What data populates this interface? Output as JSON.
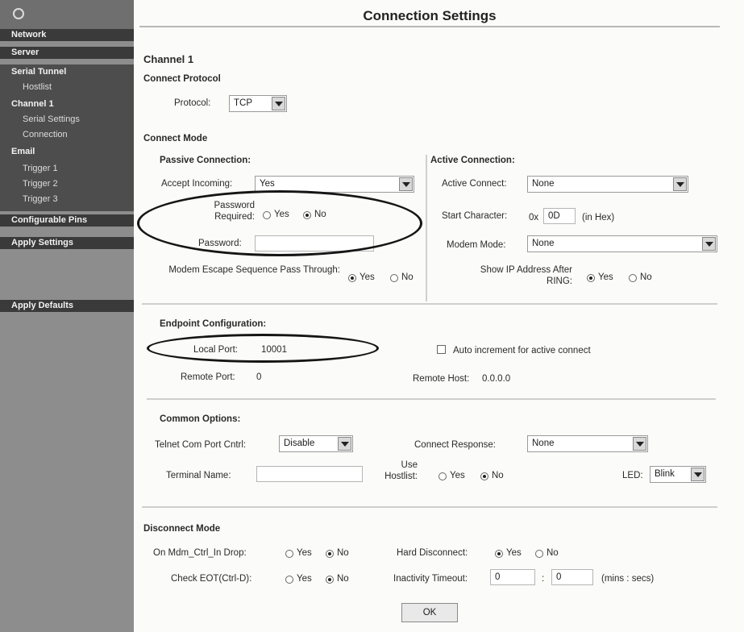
{
  "sidebar": {
    "items": [
      {
        "label": "Network"
      },
      {
        "label": "Server"
      },
      {
        "label": "Serial Tunnel"
      },
      {
        "label": "Hostlist"
      },
      {
        "label": "Channel 1"
      },
      {
        "label": "Serial Settings"
      },
      {
        "label": "Connection"
      },
      {
        "label": "Email"
      },
      {
        "label": "Trigger 1"
      },
      {
        "label": "Trigger 2"
      },
      {
        "label": "Trigger 3"
      },
      {
        "label": "Configurable Pins"
      },
      {
        "label": "Apply Settings"
      },
      {
        "label": "Apply Defaults"
      }
    ]
  },
  "page": {
    "title": "Connection Settings",
    "channel": "Channel 1"
  },
  "protocol": {
    "heading": "Connect Protocol",
    "label": "Protocol:",
    "value": "TCP"
  },
  "connect_mode": {
    "heading": "Connect Mode",
    "passive": {
      "heading": "Passive Connection:",
      "accept_incoming_label": "Accept Incoming:",
      "accept_incoming_value": "Yes",
      "password_required_label": "Password Required:",
      "yes": "Yes",
      "no": "No",
      "password_label": "Password:",
      "password_value": "",
      "modem_escape_label": "Modem Escape Sequence Pass Through:"
    },
    "active": {
      "heading": "Active Connection:",
      "active_connect_label": "Active Connect:",
      "active_connect_value": "None",
      "start_character_label": "Start Character:",
      "start_character_prefix": "0x",
      "start_character_value": "0D",
      "start_character_unit": "(in Hex)",
      "modem_mode_label": "Modem Mode:",
      "modem_mode_value": "None",
      "show_ip_label": "Show IP Address After RING:",
      "yes": "Yes",
      "no": "No"
    }
  },
  "endpoint": {
    "heading": "Endpoint Configuration:",
    "local_port_label": "Local Port:",
    "local_port_value": "10001",
    "auto_increment_label": "Auto increment for active connect",
    "remote_port_label": "Remote Port:",
    "remote_port_value": "0",
    "remote_host_label": "Remote Host:",
    "remote_host_value": "0.0.0.0"
  },
  "common": {
    "heading": "Common Options:",
    "telnet_label": "Telnet Com Port Cntrl:",
    "telnet_value": "Disable",
    "connect_response_label": "Connect Response:",
    "connect_response_value": "None",
    "terminal_name_label": "Terminal Name:",
    "terminal_name_value": "",
    "use_hostlist_label": "Use Hostlist:",
    "yes": "Yes",
    "no": "No",
    "led_label": "LED:",
    "led_value": "Blink"
  },
  "disconnect": {
    "heading": "Disconnect Mode",
    "on_mdm_label": "On Mdm_Ctrl_In Drop:",
    "hard_disconnect_label": "Hard Disconnect:",
    "check_eot_label": "Check EOT(Ctrl-D):",
    "inactivity_label": "Inactivity Timeout:",
    "inactivity_min": "0",
    "separator": ":",
    "inactivity_sec": "0",
    "inactivity_unit": "(mins : secs)",
    "yes": "Yes",
    "no": "No"
  },
  "ok_label": "OK",
  "colors": {
    "sidebar": "#8d8d8d",
    "sidebar_header": "#3a3a3a",
    "annotation": "#151515"
  }
}
